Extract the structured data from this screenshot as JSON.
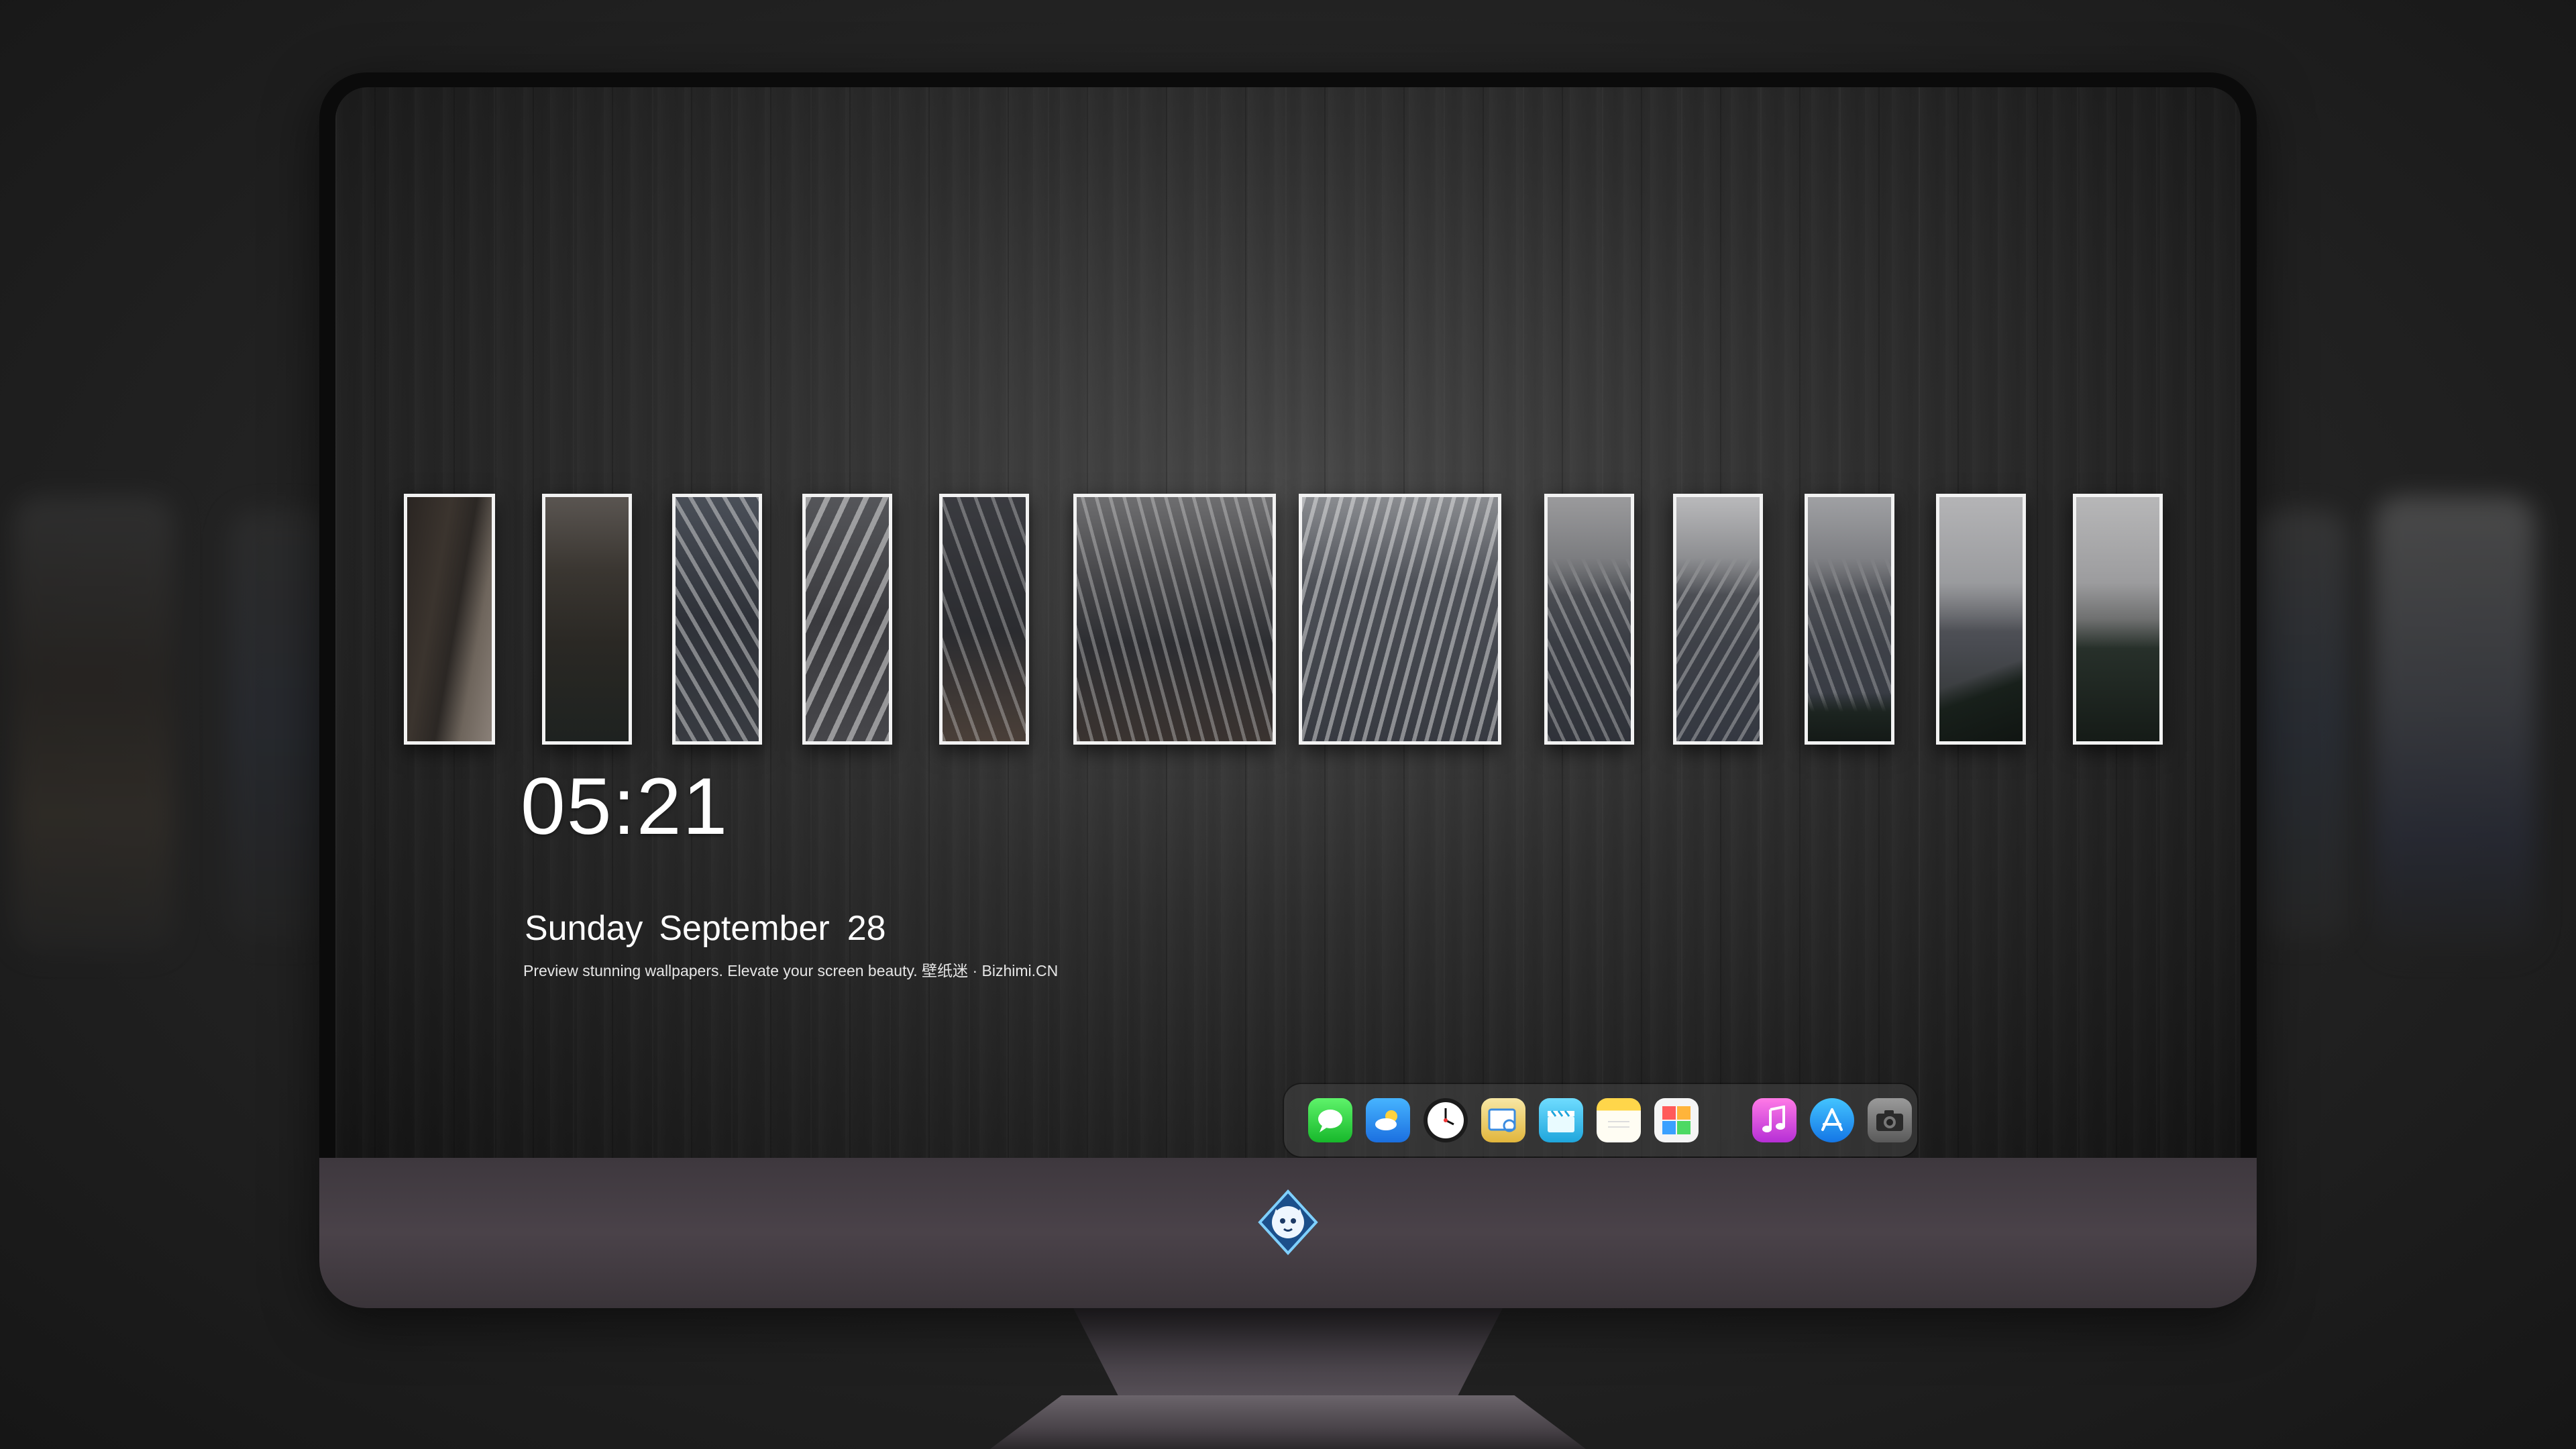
{
  "lock_screen": {
    "time": "05:21",
    "date": {
      "weekday": "Sunday",
      "month": "September",
      "day": "28"
    },
    "tagline": "Preview stunning wallpapers. Elevate your screen beauty. 壁纸迷 · Bizhimi.CN"
  },
  "gallery": {
    "tiles": [
      {
        "name": "wallpaper-strip-1",
        "theme": "rocky slope"
      },
      {
        "name": "wallpaper-strip-2",
        "theme": "dark cliff forest"
      },
      {
        "name": "wallpaper-strip-3",
        "theme": "snowy rock face"
      },
      {
        "name": "wallpaper-strip-4",
        "theme": "snowy ridge"
      },
      {
        "name": "wallpaper-strip-5",
        "theme": "snowy peak"
      },
      {
        "name": "wallpaper-tile-6",
        "theme": "mountain under cloudy sky"
      },
      {
        "name": "wallpaper-tile-7",
        "theme": "snowy mountain face"
      },
      {
        "name": "wallpaper-strip-8",
        "theme": "peak under clouds"
      },
      {
        "name": "wallpaper-strip-9",
        "theme": "snowy slope"
      },
      {
        "name": "wallpaper-strip-10",
        "theme": "mountain with forest"
      },
      {
        "name": "wallpaper-strip-11",
        "theme": "ridge and forest"
      },
      {
        "name": "wallpaper-strip-12",
        "theme": "forest under clouds"
      }
    ]
  },
  "dock": {
    "apps": [
      {
        "name": "messages",
        "icon": "messages-icon",
        "color": "#2ecc40"
      },
      {
        "name": "weather",
        "icon": "weather-icon",
        "color": "#1e90ff"
      },
      {
        "name": "clock",
        "icon": "clock-icon",
        "color": "#ffffff"
      },
      {
        "name": "preview",
        "icon": "preview-icon",
        "color": "#f4c542"
      },
      {
        "name": "clips",
        "icon": "clapperboard-icon",
        "color": "#2fb8e8"
      },
      {
        "name": "notes",
        "icon": "notes-icon",
        "color": "#ffd84a"
      },
      {
        "name": "photo-booth",
        "icon": "photos-icon",
        "color": "#ff5a5a"
      },
      {
        "name": "music",
        "icon": "music-icon",
        "color": "#d63bd6"
      },
      {
        "name": "app-store",
        "icon": "app-store-icon",
        "color": "#1ea1ff"
      },
      {
        "name": "camera",
        "icon": "camera-icon",
        "color": "#7a7a7a"
      }
    ]
  },
  "brand": {
    "logo": "mascot-logo-icon"
  },
  "colors": {
    "frame_border": "#f2f2f2",
    "chin": "#4a4249",
    "text": "#ffffff"
  }
}
